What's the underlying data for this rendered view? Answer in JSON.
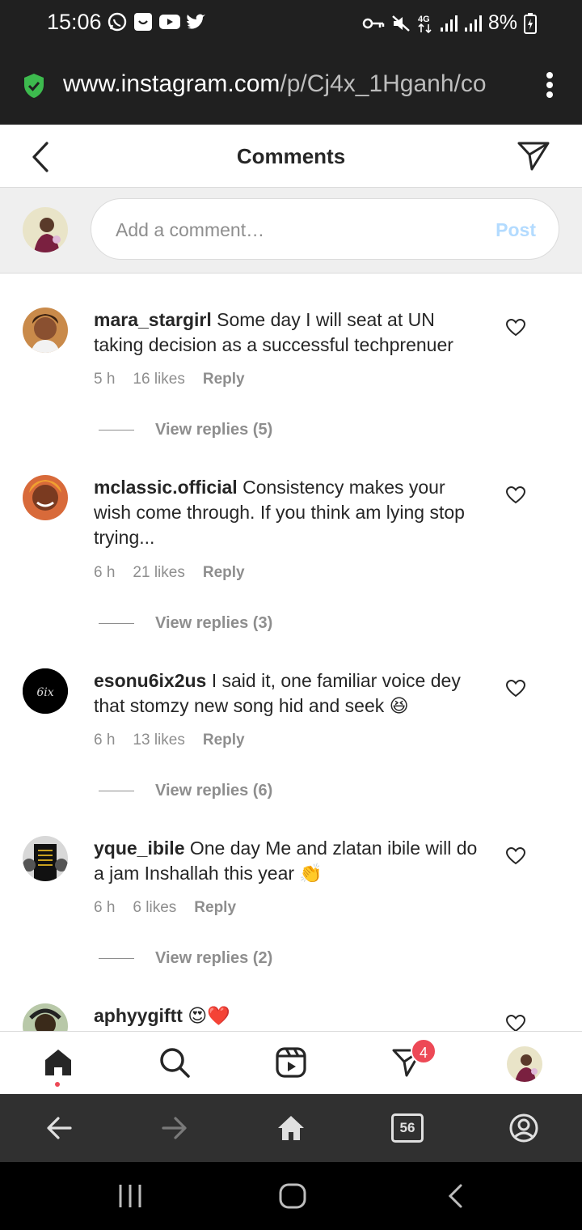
{
  "status_bar": {
    "time": "15:06",
    "battery": "8%",
    "notification_icons": [
      "whatsapp-icon",
      "instagram-icon",
      "youtube-icon",
      "twitter-icon"
    ],
    "system_icons": [
      "vpn-key-icon",
      "mute-icon",
      "4g-icon",
      "signal-icon",
      "signal-icon",
      "battery-charging-icon"
    ]
  },
  "browser": {
    "url_host": "www.instagram.com",
    "url_path": "/p/Cj4x_1Hganh/co",
    "secure_color": "#3dba4e",
    "tabs_count": "56"
  },
  "header": {
    "title": "Comments"
  },
  "add_comment": {
    "placeholder": "Add a comment…",
    "post_label": "Post"
  },
  "comments": [
    {
      "username": "mara_stargirl",
      "text": "Some day I will seat at UN taking decision as a successful techprenuer",
      "time": "5 h",
      "likes": "16 likes",
      "reply_label": "Reply",
      "view_replies": "View replies (5)"
    },
    {
      "username": "mclassic.official",
      "text": "Consistency makes your wish come through. If you think am lying stop trying...",
      "time": "6 h",
      "likes": "21 likes",
      "reply_label": "Reply",
      "view_replies": "View replies (3)"
    },
    {
      "username": "esonu6ix2us",
      "text": "I said it, one familiar voice dey that stomzy new song hid and seek 😆",
      "time": "6 h",
      "likes": "13 likes",
      "reply_label": "Reply",
      "view_replies": "View replies (6)",
      "avatar_text": "6ix"
    },
    {
      "username": "yque_ibile",
      "text": "One day Me and zlatan ibile will do a jam Inshallah this year 👏",
      "time": "6 h",
      "likes": "6 likes",
      "reply_label": "Reply",
      "view_replies": "View replies (2)"
    },
    {
      "username": "aphyygiftt",
      "text": "😍❤️"
    }
  ],
  "ig_nav": {
    "items": [
      "home-icon",
      "search-icon",
      "reels-icon",
      "direct-icon",
      "profile-avatar"
    ],
    "direct_badge": "4"
  },
  "browser_nav": {
    "items": [
      "back-arrow-icon",
      "forward-arrow-icon",
      "home-icon",
      "tabs-icon",
      "account-icon"
    ]
  },
  "android_nav": {
    "items": [
      "recents-icon",
      "home-icon",
      "back-icon"
    ]
  }
}
